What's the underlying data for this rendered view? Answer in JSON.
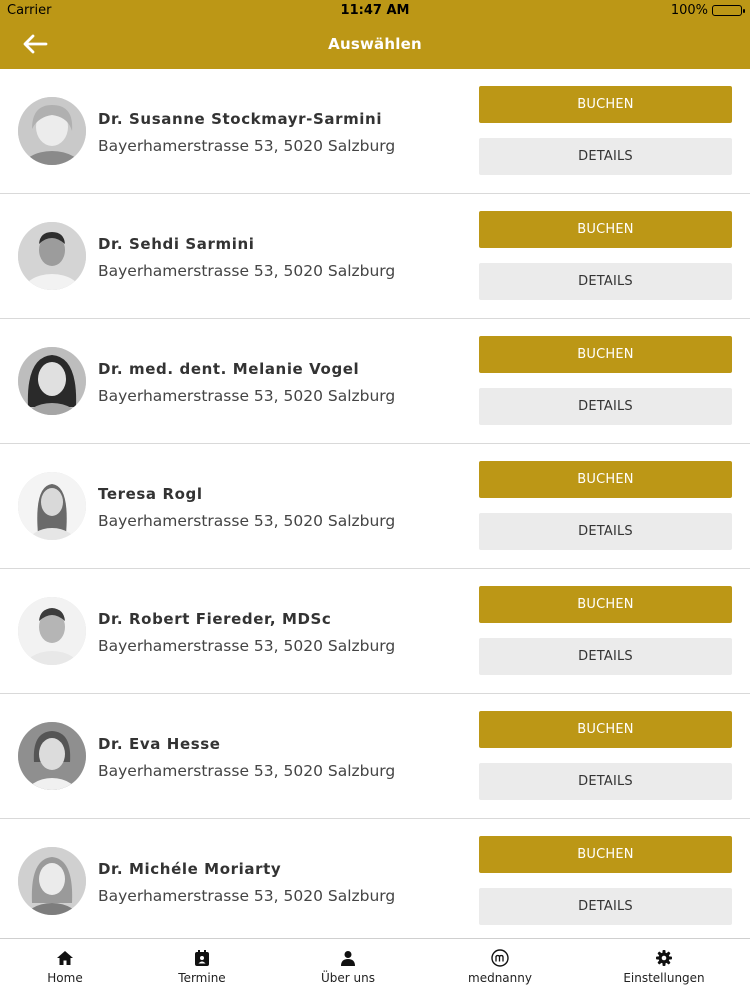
{
  "status_bar": {
    "carrier": "Carrier",
    "time": "11:47 AM",
    "battery": "100%"
  },
  "nav": {
    "title": "Auswählen",
    "back_icon": "arrow-left-icon"
  },
  "colors": {
    "accent": "#bc9716",
    "secondary_button": "#ebebeb"
  },
  "doctors": [
    {
      "name": "Dr. Susanne Stockmayr-Sarmini",
      "address": "Bayerhamerstrasse 53, 5020 Salzburg",
      "book_label": "BUCHEN",
      "details_label": "DETAILS"
    },
    {
      "name": "Dr. Sehdi Sarmini",
      "address": "Bayerhamerstrasse 53, 5020 Salzburg",
      "book_label": "BUCHEN",
      "details_label": "DETAILS"
    },
    {
      "name": "Dr. med. dent. Melanie Vogel",
      "address": "Bayerhamerstrasse 53, 5020 Salzburg",
      "book_label": "BUCHEN",
      "details_label": "DETAILS"
    },
    {
      "name": "Teresa Rogl",
      "address": "Bayerhamerstrasse 53, 5020 Salzburg",
      "book_label": "BUCHEN",
      "details_label": "DETAILS"
    },
    {
      "name": "Dr. Robert Fiereder, MDSc",
      "address": "Bayerhamerstrasse 53, 5020 Salzburg",
      "book_label": "BUCHEN",
      "details_label": "DETAILS"
    },
    {
      "name": "Dr. Eva Hesse",
      "address": "Bayerhamerstrasse 53, 5020 Salzburg",
      "book_label": "BUCHEN",
      "details_label": "DETAILS"
    },
    {
      "name": "Dr. Michéle Moriarty",
      "address": "Bayerhamerstrasse 53, 5020 Salzburg",
      "book_label": "BUCHEN",
      "details_label": "DETAILS"
    }
  ],
  "tabbar": [
    {
      "label": "Home",
      "icon": "home-icon"
    },
    {
      "label": "Termine",
      "icon": "calendar-icon"
    },
    {
      "label": "Über uns",
      "icon": "person-icon"
    },
    {
      "label": "mednanny",
      "icon": "mednanny-icon"
    },
    {
      "label": "Einstellungen",
      "icon": "gear-icon"
    }
  ]
}
